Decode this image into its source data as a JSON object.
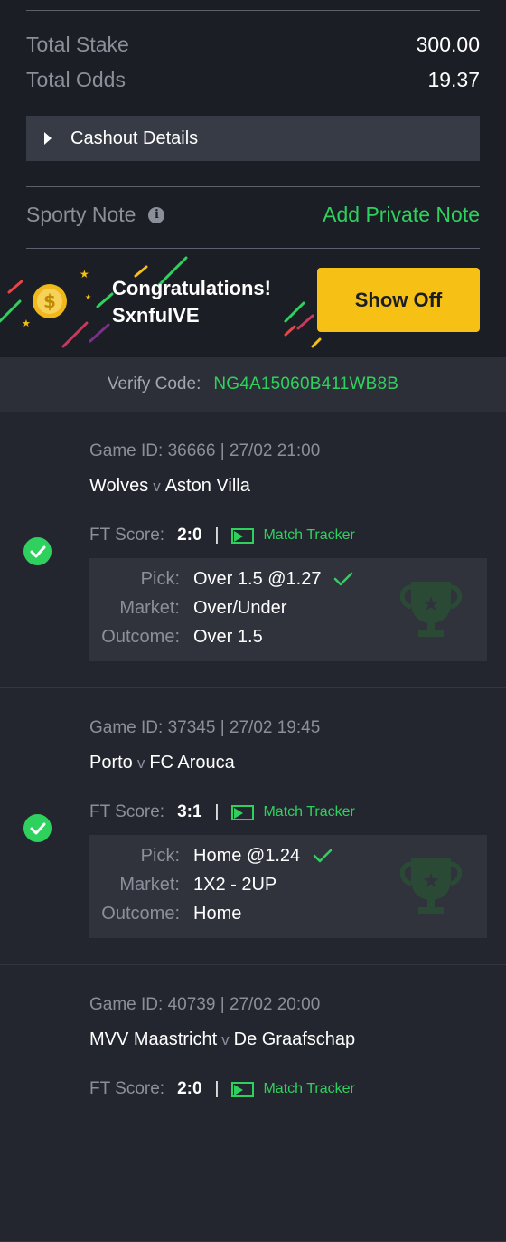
{
  "summary": {
    "total_stake_label": "Total Stake",
    "total_stake_value": "300.00",
    "total_odds_label": "Total Odds",
    "total_odds_value": "19.37",
    "cashout_label": "Cashout Details",
    "sporty_note_label": "Sporty Note",
    "add_note_label": "Add Private Note"
  },
  "banner": {
    "congrats_line1": "Congratulations!",
    "congrats_line2": "SxnfulVE",
    "show_off_label": "Show Off"
  },
  "verify": {
    "label": "Verify Code:",
    "code": "NG4A15060B411WB8B"
  },
  "labels": {
    "ft_score": "FT Score:",
    "pipe": "|",
    "match_tracker": "Match Tracker",
    "vs": "v",
    "pick": "Pick:",
    "market": "Market:",
    "outcome": "Outcome:"
  },
  "games": [
    {
      "game_id": "Game ID: 36666 | 27/02 21:00",
      "home": "Wolves",
      "away": "Aston Villa",
      "ft_score": "2:0",
      "pick": "Over 1.5 @1.27",
      "market": "Over/Under",
      "outcome": "Over 1.5",
      "status": "won"
    },
    {
      "game_id": "Game ID: 37345 | 27/02 19:45",
      "home": "Porto",
      "away": "FC Arouca",
      "ft_score": "3:1",
      "pick": "Home @1.24",
      "market": "1X2 - 2UP",
      "outcome": "Home",
      "status": "won"
    },
    {
      "game_id": "Game ID: 40739 | 27/02 20:00",
      "home": "MVV Maastricht",
      "away": "De Graafschap",
      "ft_score": "2:0",
      "pick": "",
      "market": "",
      "outcome": "",
      "status": "won"
    }
  ],
  "colors": {
    "accent_green": "#2fd15e",
    "button_yellow": "#f6c014",
    "background": "#1b1e25"
  }
}
